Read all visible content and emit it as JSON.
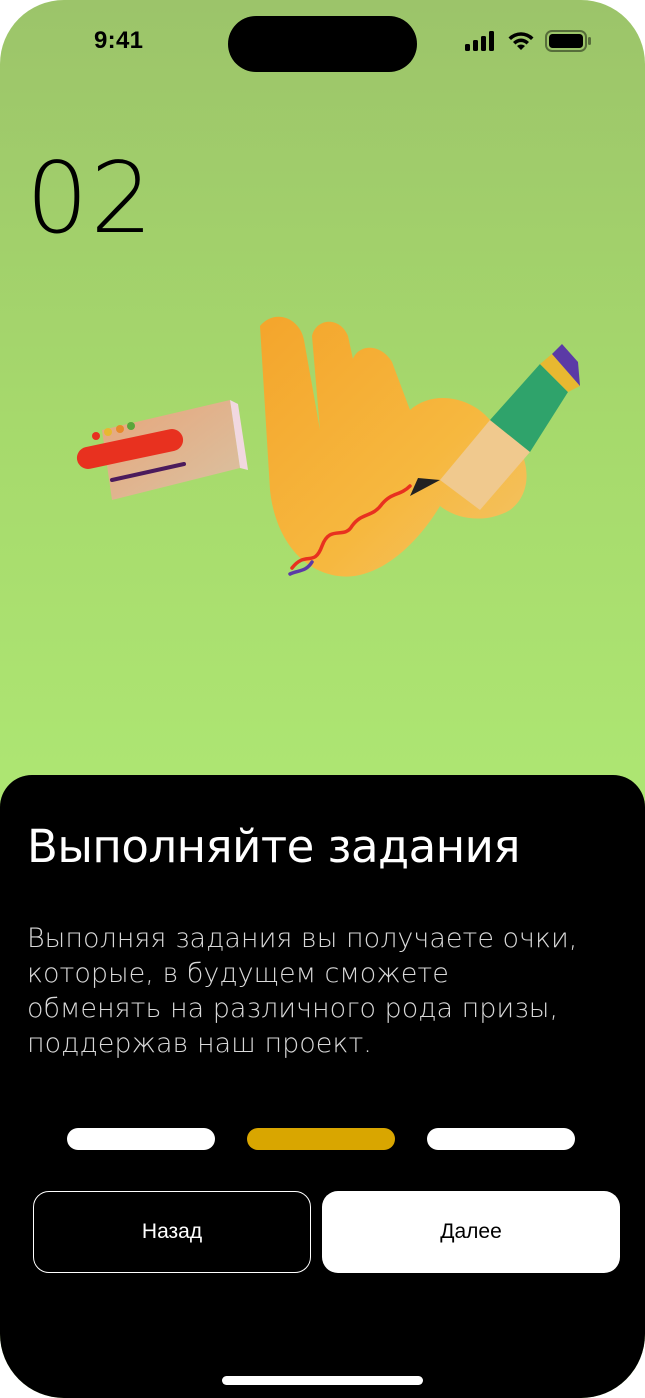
{
  "status_bar": {
    "time": "9:41",
    "icons": [
      "cellular-signal-icon",
      "wifi-icon",
      "battery-icon"
    ]
  },
  "onboarding": {
    "step_number": "02",
    "illustration": "hand-with-pencil-and-card",
    "title": "Выполняйте задания",
    "description": "Выполняя задания вы получаете очки, которые, в будущем сможете обменять на различного рода призы, поддержав наш проект.",
    "progress": {
      "total_steps": 3,
      "current_step": 2
    },
    "buttons": {
      "back_label": "Назад",
      "next_label": "Далее"
    }
  },
  "colors": {
    "background": "#ade572",
    "sheet": "#000000",
    "accent": "#d9a600",
    "text_primary": "#ffffff"
  }
}
